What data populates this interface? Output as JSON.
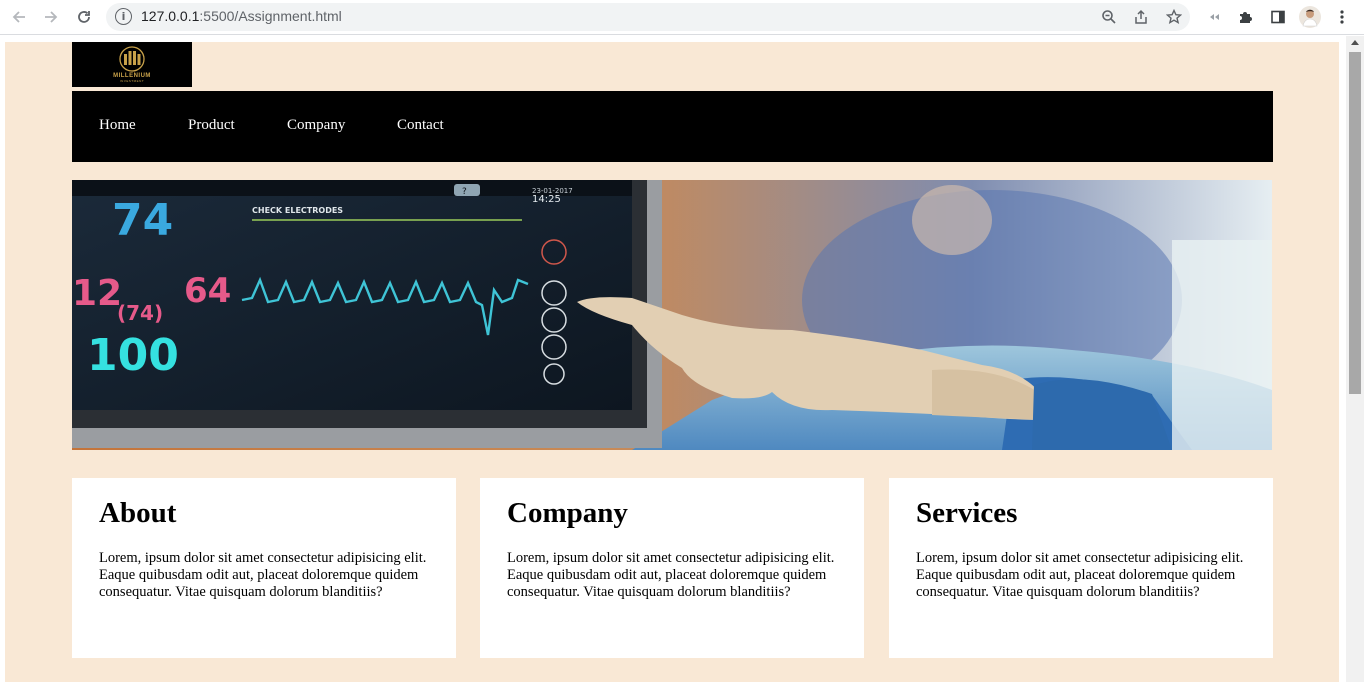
{
  "browser": {
    "url_host": "127.0.0.1",
    "url_rest": ":5500/Assignment.html"
  },
  "site": {
    "logo_name": "MILLENIUM",
    "logo_subtitle": "INVESTMENT",
    "nav": [
      {
        "label": "Home"
      },
      {
        "label": "Product"
      },
      {
        "label": "Company"
      },
      {
        "label": "Contact"
      }
    ],
    "cards": [
      {
        "title": "About",
        "text": "Lorem, ipsum dolor sit amet consectetur adipisicing elit. Eaque quibusdam odit aut, placeat doloremque quidem consequatur. Vitae quisquam dolorum blanditiis?"
      },
      {
        "title": "Company",
        "text": "Lorem, ipsum dolor sit amet consectetur adipisicing elit. Eaque quibusdam odit aut, placeat doloremque quidem consequatur. Vitae quisquam dolorum blanditiis?"
      },
      {
        "title": "Services",
        "text": "Lorem, ipsum dolor sit amet consectetur adipisicing elit. Eaque quibusdam odit aut, placeat doloremque quidem consequatur. Vitae quisquam dolorum blanditiis?"
      }
    ],
    "hero": {
      "monitor_readings": [
        "74",
        "12",
        "64",
        "(74)",
        "100"
      ],
      "monitor_header": "CHECK ELECTRODES",
      "monitor_date": "23-01-2017",
      "monitor_time": "14:25",
      "monitor_help": "?"
    }
  },
  "colors": {
    "page_background": "#f9e8d5",
    "nav_background": "#000000",
    "nav_text": "#ffffff",
    "card_background": "#ffffff",
    "logo_gold": "#c9a24a"
  }
}
